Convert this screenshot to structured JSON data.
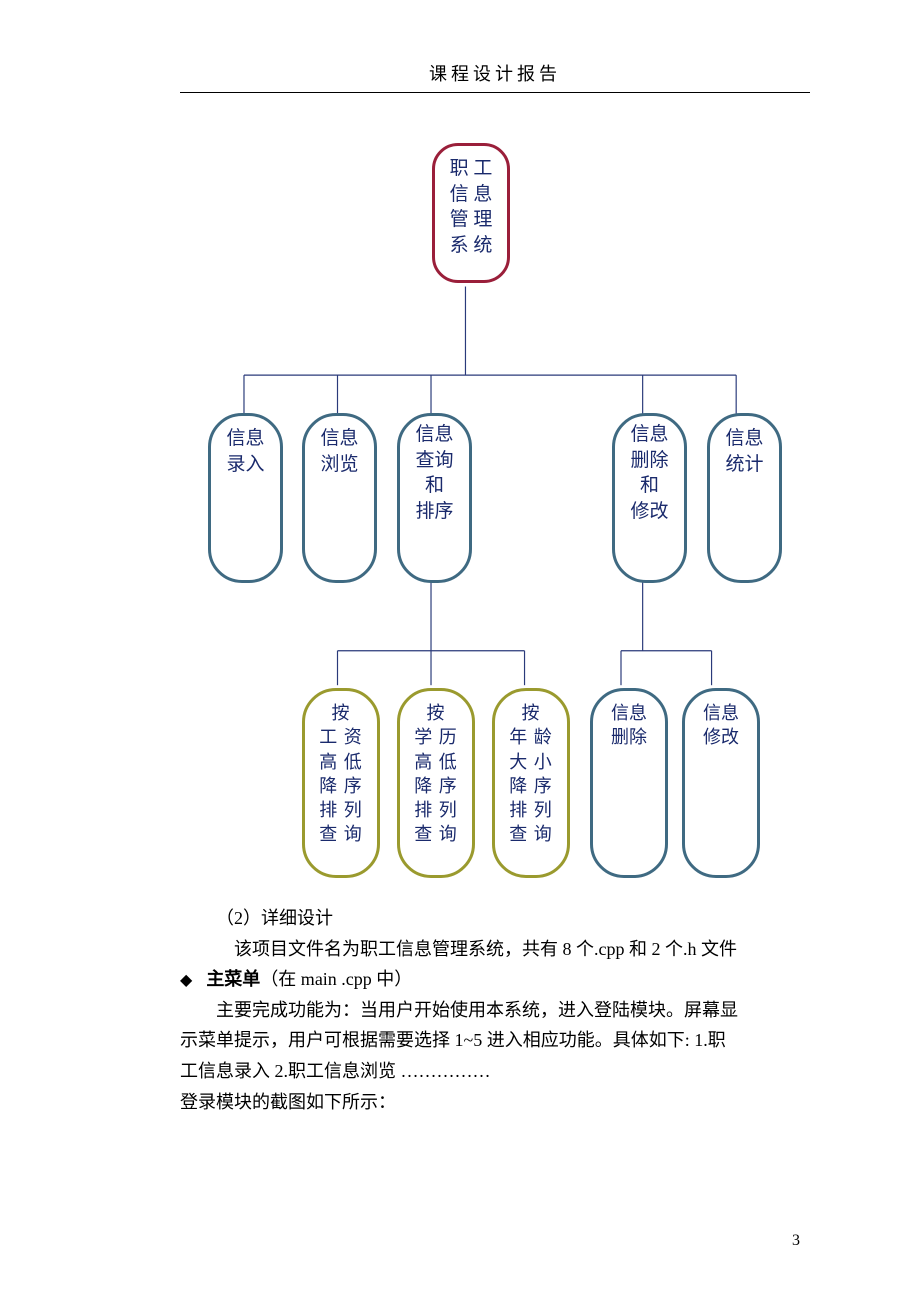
{
  "header": "课程设计报告",
  "diagram": {
    "root": "职 工\n信 息\n管 理\n系 统",
    "level1": [
      "信息\n录入",
      "信息\n浏览",
      "信息\n查询\n和\n排序",
      "信息\n删除\n和\n修改",
      "信息\n统计"
    ],
    "leaves_olive": [
      "按\n工 资\n高 低\n降 序\n排 列\n查 询",
      "按\n学 历\n高 低\n降 序\n排 列\n查 询",
      "按\n年 龄\n大 小\n降 序\n排 列\n查 询"
    ],
    "leaves_blue": [
      "信息\n删除",
      "信息\n修改"
    ]
  },
  "text": {
    "sec2": "（2）详细设计",
    "p1": "该项目文件名为职工信息管理系统，共有 8 个.cpp 和 2 个.h 文件",
    "bullet_bold": "主菜单",
    "bullet_rest": "（在 main .cpp 中）",
    "p2a": "主要完成功能为：当用户开始使用本系统，进入登陆模块。屏幕显",
    "p2b": "示菜单提示，用户可根据需要选择 1~5 进入相应功能。具体如下: 1.职",
    "p2c": "工信息录入  2.职工信息浏览  ……………",
    "p3": "登录模块的截图如下所示："
  },
  "page_number": "3"
}
